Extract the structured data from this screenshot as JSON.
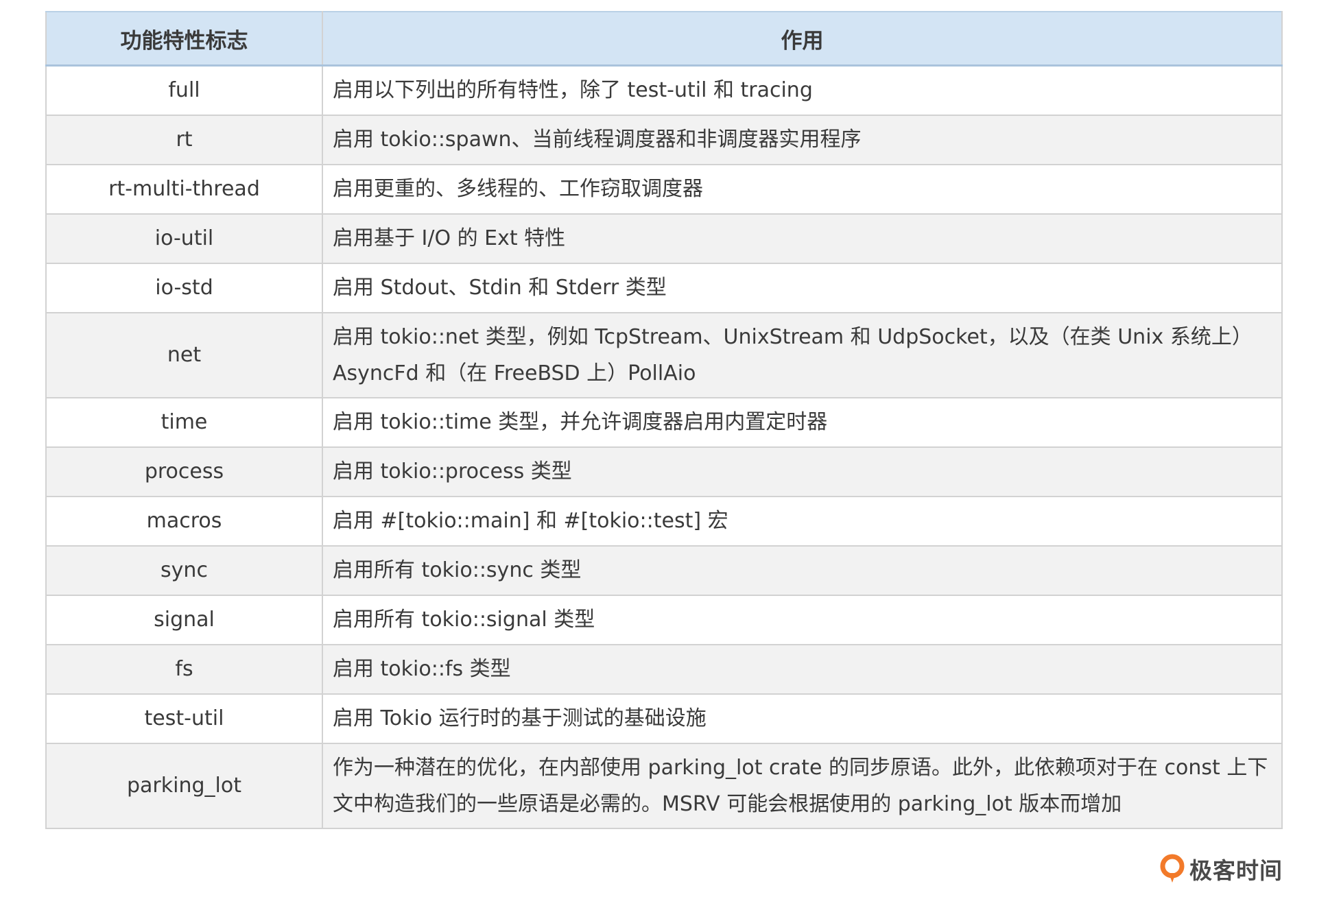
{
  "table": {
    "headers": [
      "功能特性标志",
      "作用"
    ],
    "rows": [
      {
        "flag": "full",
        "desc": "启用以下列出的所有特性，除了 test-util 和 tracing"
      },
      {
        "flag": "rt",
        "desc": "启用 tokio::spawn、当前线程调度器和非调度器实用程序"
      },
      {
        "flag": "rt-multi-thread",
        "desc": "启用更重的、多线程的、工作窃取调度器"
      },
      {
        "flag": "io-util",
        "desc": "启用基于 I/O 的 Ext 特性"
      },
      {
        "flag": "io-std",
        "desc": "启用 Stdout、Stdin 和 Stderr 类型"
      },
      {
        "flag": "net",
        "desc": "启用 tokio::net 类型，例如 TcpStream、UnixStream 和 UdpSocket，以及（在类 Unix 系统上）AsyncFd 和（在 FreeBSD 上）PollAio"
      },
      {
        "flag": "time",
        "desc": "启用 tokio::time 类型，并允许调度器启用内置定时器"
      },
      {
        "flag": "process",
        "desc": "启用 tokio::process 类型"
      },
      {
        "flag": "macros",
        "desc": "启用 #[tokio::main] 和 #[tokio::test] 宏"
      },
      {
        "flag": "sync",
        "desc": "启用所有 tokio::sync 类型"
      },
      {
        "flag": "signal",
        "desc": "启用所有 tokio::signal 类型"
      },
      {
        "flag": "fs",
        "desc": "启用 tokio::fs 类型"
      },
      {
        "flag": "test-util",
        "desc": "启用 Tokio 运行时的基于测试的基础设施"
      },
      {
        "flag": "parking_lot",
        "desc": "作为一种潜在的优化，在内部使用 parking_lot crate 的同步原语。此外，此依赖项对于在 const 上下文中构造我们的一些原语是必需的。MSRV 可能会根据使用的 parking_lot 版本而增加"
      }
    ]
  },
  "brand": {
    "name": "极客时间",
    "icon": "geektime-logo-icon",
    "icon_color": "#f27a2a"
  }
}
